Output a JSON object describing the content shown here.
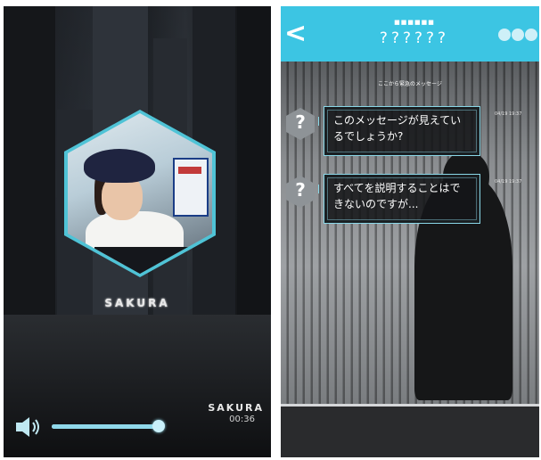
{
  "player": {
    "artist_logo": "SAKURA",
    "artist_logo_small": "SAKURA",
    "time_elapsed": "00:36",
    "volume_level": 0.97
  },
  "chat": {
    "header_subtitle": "■■■■■■",
    "header_title": "??????",
    "back_label": "<",
    "banner": "ここから緊急のメッセージ",
    "avatar_label": "?",
    "messages": [
      {
        "text": "このメッセージが見えているでしょうか?",
        "timestamp": "04/19 19:37"
      },
      {
        "text": "すべてを説明することはできないのですが...",
        "timestamp": "04/19 19:37"
      }
    ]
  },
  "colors": {
    "accent": "#3cc5e3",
    "hex_frame": "#4fc3d6",
    "slider": "#8fd8ea",
    "bubble_border": "#8ad8e8"
  },
  "icons": {
    "volume": "speaker-icon",
    "back": "chevron-left-icon",
    "more": "more-dots-icon",
    "avatar": "question-mark-icon"
  }
}
